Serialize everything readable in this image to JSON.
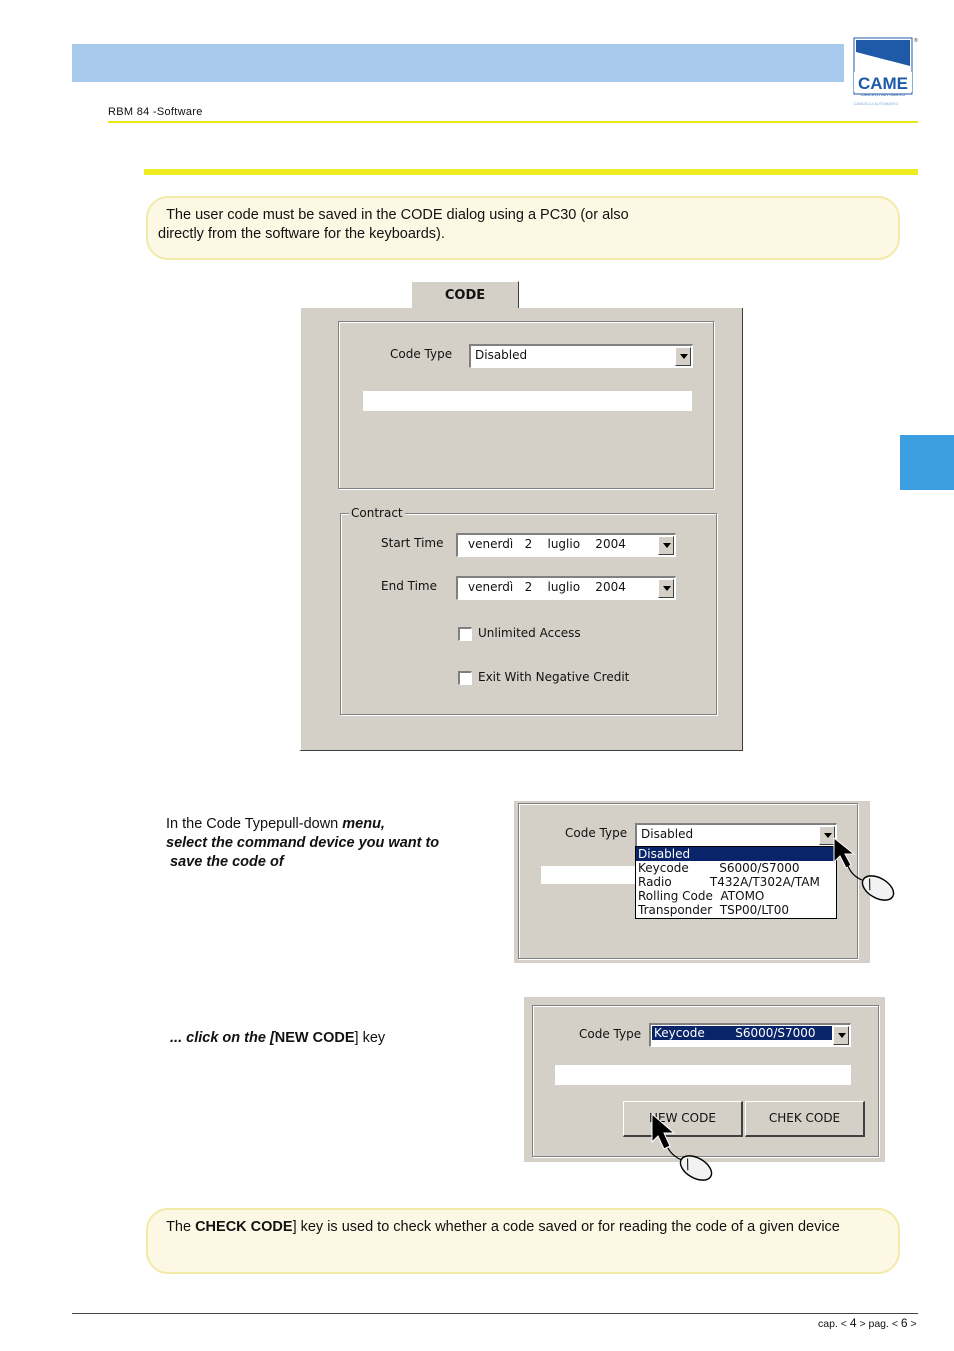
{
  "header": {
    "doc_title": "RBM 84 -Software",
    "logo_text": "CAME",
    "logo_subtext": "CANCELLI AUTOMATICI",
    "logo_tagline": "CANCELLI AUTOMATICI"
  },
  "note1": {
    "text_line1": "The user code must be saved in the CODE dialog using a PC30 (or also",
    "text_line2": "directly from the software for the keyboards)."
  },
  "dialog": {
    "tab": "CODE",
    "code_type_label": "Code Type",
    "code_type_value": "Disabled",
    "contract_label": "Contract",
    "start_time_label": "Start Time",
    "start_time_value": "venerdì   2    luglio    2004",
    "end_time_label": "End Time",
    "end_time_value": "venerdì   2    luglio    2004",
    "unlimited_access": "Unlimited Access",
    "negative_credit": "Exit With Negative Credit"
  },
  "step1": {
    "text_plain": "In the Code Typepull-down ",
    "text_bold1": "menu,",
    "text_bold2": "select the command device you want to",
    "text_bold3": " save the code of",
    "label": "Code Type",
    "value": "Disabled",
    "options": [
      "Disabled",
      "Keycode        S6000/S7000",
      "Radio          T432A/T302A/TAM",
      "Rolling Code  ATOMO",
      "Transponder  TSP00/LT00"
    ]
  },
  "step2": {
    "text_prefix": " ... click on the [",
    "text_bold": "NEW CODE",
    "text_suffix": "] key",
    "label": "Code Type",
    "value": "Keycode        S6000/S7000",
    "new_code": "NEW CODE",
    "check_code": "CHEK CODE"
  },
  "note2": {
    "text_prefix": "The ",
    "text_bold": "CHECK CODE",
    "text_suffix": "] key is used to check whether a code saved or for reading the code of a given device"
  },
  "footer": {
    "cap_label": "cap. <",
    "cap_num": "4",
    "pag_label": "> pag. <",
    "pag_num": "6",
    "end": ">"
  },
  "colors": {
    "header_band": "#a6c9ec",
    "rule": "#f0ec24",
    "side_tab": "#3d9fe0",
    "note_bg": "#fdf8e4",
    "dialog_bg": "#d4d0c8",
    "selection": "#0a246a"
  }
}
